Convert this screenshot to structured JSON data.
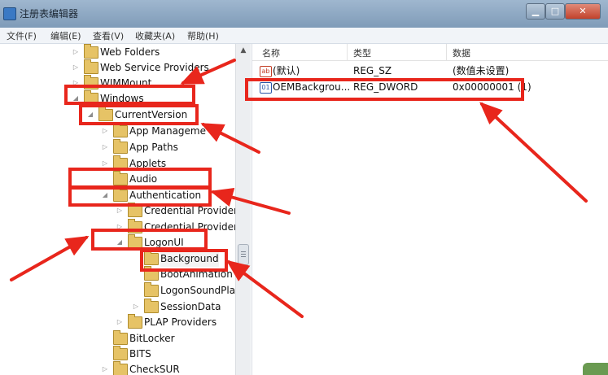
{
  "window": {
    "title": "注册表编辑器",
    "controls": {
      "minimize": "▁",
      "maximize": "□",
      "close": "✕"
    }
  },
  "menubar": {
    "items": [
      {
        "label": "文件(F)"
      },
      {
        "label": "编辑(E)"
      },
      {
        "label": "查看(V)"
      },
      {
        "label": "收藏夹(A)"
      },
      {
        "label": "帮助(H)"
      }
    ]
  },
  "tree": {
    "nodes": [
      {
        "label": "Web Folders",
        "expander": "▷"
      },
      {
        "label": "Web Service Providers",
        "expander": "▷"
      },
      {
        "label": "WIMMount",
        "expander": "▷"
      },
      {
        "label": "Windows",
        "expander": "◢"
      },
      {
        "label": "CurrentVersion",
        "expander": "◢"
      },
      {
        "label": "App Manageme",
        "expander": "▷"
      },
      {
        "label": "App Paths",
        "expander": "▷"
      },
      {
        "label": "Applets",
        "expander": "▷"
      },
      {
        "label": "Audio",
        "expander": ""
      },
      {
        "label": "Authentication",
        "expander": "◢"
      },
      {
        "label": "Credential Provider",
        "expander": "▷"
      },
      {
        "label": "Credential Provider",
        "expander": "▷"
      },
      {
        "label": "LogonUI",
        "expander": "◢"
      },
      {
        "label": "Background",
        "expander": ""
      },
      {
        "label": "BootAnimation",
        "expander": ""
      },
      {
        "label": "LogonSoundPla",
        "expander": ""
      },
      {
        "label": "SessionData",
        "expander": "▷"
      },
      {
        "label": "PLAP Providers",
        "expander": "▷"
      },
      {
        "label": "BitLocker",
        "expander": ""
      },
      {
        "label": "BITS",
        "expander": ""
      },
      {
        "label": "CheckSUR",
        "expander": "▷"
      }
    ],
    "scroll_up": "▲"
  },
  "values_pane": {
    "columns": {
      "name": "名称",
      "type": "类型",
      "data": "数据"
    },
    "rows": [
      {
        "name": "(默认)",
        "type": "REG_SZ",
        "data": "(数值未设置)",
        "icon": "ab",
        "icon_name": "string-value-icon"
      },
      {
        "name": "OEMBackgrou...",
        "type": "REG_DWORD",
        "data": "0x00000001 (1)",
        "icon": "01",
        "icon_name": "dword-value-icon"
      }
    ]
  },
  "annotations": {
    "color": "#e8261c"
  },
  "colors": {
    "titlebar": "#8ea8c3",
    "annotation_red": "#e8261c",
    "folder": "#e6c366"
  }
}
